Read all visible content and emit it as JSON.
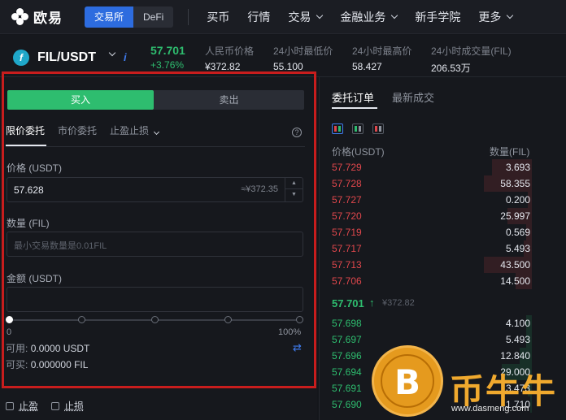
{
  "nav": {
    "brand": "欧易",
    "mode_tabs": [
      "交易所",
      "DeFi"
    ],
    "menu": [
      "买币",
      "行情",
      "交易",
      "金融业务",
      "新手学院",
      "更多"
    ]
  },
  "ticker": {
    "pair": "FIL/USDT",
    "coin_symbol": "f",
    "last_price": "57.701",
    "change": "+3.76%",
    "stats": [
      {
        "label": "人民币价格",
        "value": "¥372.82"
      },
      {
        "label": "24小时最低价",
        "value": "55.100"
      },
      {
        "label": "24小时最高价",
        "value": "58.427"
      },
      {
        "label": "24小时成交量(FIL)",
        "value": "206.53万"
      }
    ]
  },
  "order_form": {
    "buy_label": "买入",
    "sell_label": "卖出",
    "tabs": [
      "限价委托",
      "市价委托",
      "止盈止损"
    ],
    "price_label": "价格 (USDT)",
    "price_value": "57.628",
    "price_approx": "≈¥372.35",
    "amount_label": "数量 (FIL)",
    "amount_placeholder": "最小交易数量是0.01FIL",
    "total_label": "金额 (USDT)",
    "slider_min": "0",
    "slider_max": "100%",
    "available_label": "可用:",
    "available_value": "0.0000 USDT",
    "buyable_label": "可买:",
    "buyable_value": "0.000000 FIL",
    "take_profit": "止盈",
    "stop_loss": "止损"
  },
  "order_book": {
    "tabs": [
      "委托订单",
      "最新成交"
    ],
    "price_header": "价格(USDT)",
    "qty_header": "数量(FIL)",
    "asks": [
      {
        "price": "57.729",
        "qty": "3.693",
        "depth": 0.2
      },
      {
        "price": "57.728",
        "qty": "58.355",
        "depth": 0.24
      },
      {
        "price": "57.727",
        "qty": "0.200",
        "depth": 0.02
      },
      {
        "price": "57.720",
        "qty": "25.997",
        "depth": 0.12
      },
      {
        "price": "57.719",
        "qty": "0.569",
        "depth": 0.03
      },
      {
        "price": "57.717",
        "qty": "5.493",
        "depth": 0.04
      },
      {
        "price": "57.713",
        "qty": "43.500",
        "depth": 0.24
      },
      {
        "price": "57.706",
        "qty": "14.500",
        "depth": 0.08
      }
    ],
    "mid_price": "57.701",
    "mid_cny": "¥372.82",
    "bids": [
      {
        "price": "57.698",
        "qty": "4.100",
        "depth": 0.03
      },
      {
        "price": "57.697",
        "qty": "5.493",
        "depth": 0.03
      },
      {
        "price": "57.696",
        "qty": "12.840",
        "depth": 0.06
      },
      {
        "price": "57.694",
        "qty": "29.000",
        "depth": 0.15
      },
      {
        "price": "57.691",
        "qty": "3.473",
        "depth": 0.02
      },
      {
        "price": "57.690",
        "qty": "1.710",
        "depth": 0.01
      }
    ]
  },
  "watermark": {
    "coin_glyph": "B",
    "text": "币牛牛",
    "url": "www.dasmeng.com"
  }
}
